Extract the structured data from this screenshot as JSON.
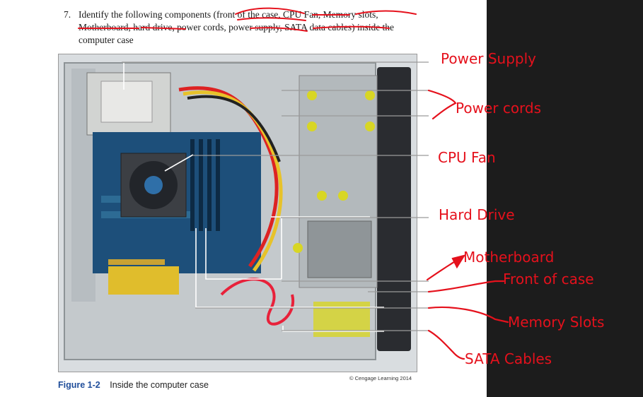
{
  "question": {
    "number": "7.",
    "text": "Identify the following components (front of the case, CPU Fan, Memory slots, Motherboard, hard drive, power cords, power supply, SATA data cables) inside the computer case"
  },
  "figure": {
    "caption_label": "Figure 1-2",
    "caption_text": "Inside the computer case",
    "credit": "© Cengage Learning 2014"
  },
  "callouts": {
    "power_supply": "Power Supply",
    "power_cords": "Power cords",
    "cpu_fan": "CPU Fan",
    "hard_drive": "Hard Drive",
    "motherboard": "Motherboard",
    "front_of_case": "Front of case",
    "memory_slots": "Memory Slots",
    "sata_cables": "SATA Cables"
  },
  "colors": {
    "annotation": "#e5111c",
    "caption_label": "#1f4d9a",
    "dark_panel": "#1c1c1c"
  }
}
